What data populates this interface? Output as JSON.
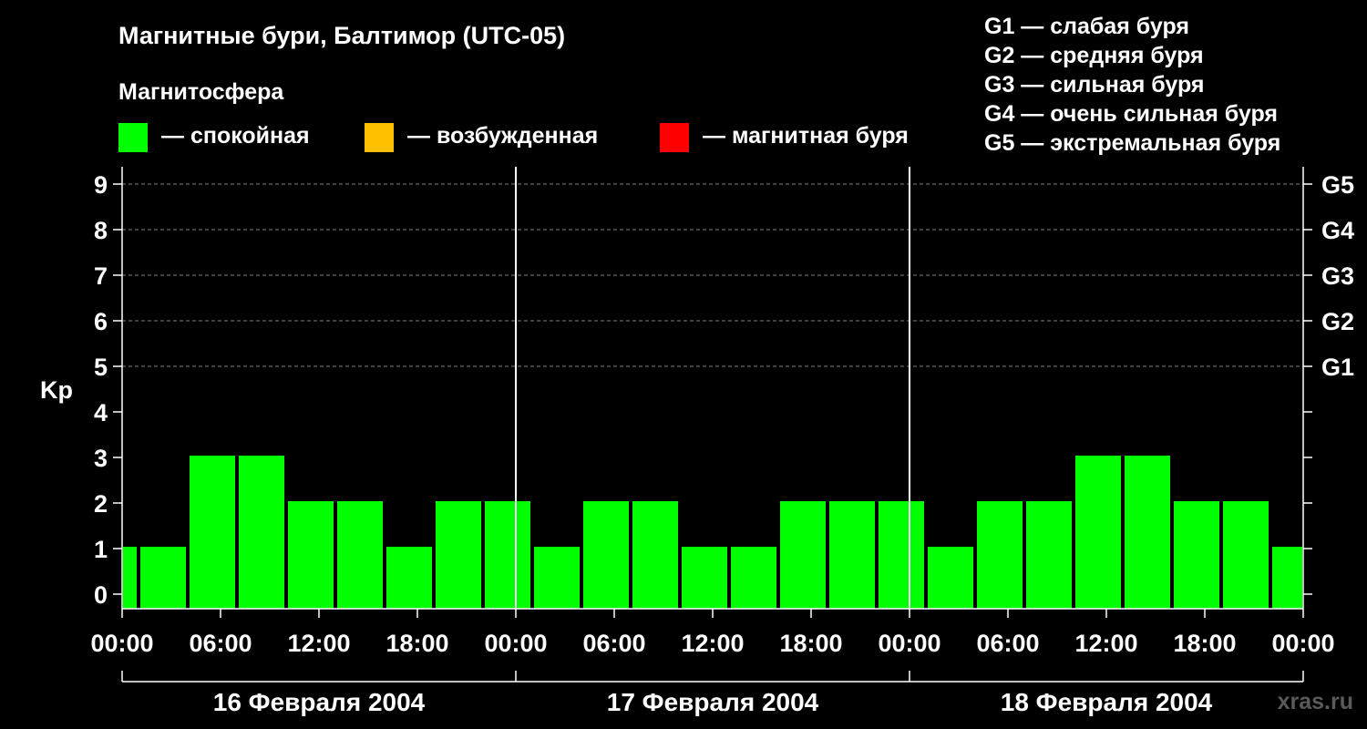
{
  "title": "Магнитные бури, Балтимор (UTC-05)",
  "subtitle": "Магнитосфера",
  "status_legend": [
    {
      "label": "— спокойная",
      "color": "#00ff00"
    },
    {
      "label": "— возбужденная",
      "color": "#ffc000"
    },
    {
      "label": "— магнитная буря",
      "color": "#ff0000"
    }
  ],
  "storm_legend": [
    "G1 — слабая буря",
    "G2 — средняя буря",
    "G3 — сильная буря",
    "G4 — очень сильная буря",
    "G5 — экстремальная буря"
  ],
  "watermark": "xras.ru",
  "colors": {
    "bar": "#00ff00",
    "background": "#000000",
    "axis": "#ffffff",
    "grid": "#808080"
  },
  "chart_data": {
    "type": "bar",
    "ylabel": "Kp",
    "ylim": [
      0,
      9
    ],
    "y_ticks": [
      "0",
      "1",
      "2",
      "3",
      "4",
      "5",
      "6",
      "7",
      "8",
      "9"
    ],
    "right_ticks": [
      {
        "value": 5,
        "label": "G1"
      },
      {
        "value": 6,
        "label": "G2"
      },
      {
        "value": 7,
        "label": "G3"
      },
      {
        "value": 8,
        "label": "G4"
      },
      {
        "value": 9,
        "label": "G5"
      }
    ],
    "grid_y": [
      5,
      6,
      7,
      8,
      9
    ],
    "x_hour_range": [
      0,
      72
    ],
    "x_tick_labels": [
      "00:00",
      "06:00",
      "12:00",
      "18:00",
      "00:00",
      "06:00",
      "12:00",
      "18:00",
      "00:00",
      "06:00",
      "12:00",
      "18:00",
      "00:00"
    ],
    "x_tick_hours": [
      0,
      6,
      12,
      18,
      24,
      30,
      36,
      42,
      48,
      54,
      60,
      66,
      72
    ],
    "days": [
      {
        "label": "16 Февраля 2004",
        "start_hour": 0,
        "end_hour": 24
      },
      {
        "label": "17 Февраля 2004",
        "start_hour": 24,
        "end_hour": 48
      },
      {
        "label": "18 Февраля 2004",
        "start_hour": 48,
        "end_hour": 72
      }
    ],
    "bars": [
      {
        "start": 0,
        "end": 1,
        "kp": 1
      },
      {
        "start": 1,
        "end": 4,
        "kp": 1
      },
      {
        "start": 4,
        "end": 7,
        "kp": 3
      },
      {
        "start": 7,
        "end": 10,
        "kp": 3
      },
      {
        "start": 10,
        "end": 13,
        "kp": 2
      },
      {
        "start": 13,
        "end": 16,
        "kp": 2
      },
      {
        "start": 16,
        "end": 19,
        "kp": 1
      },
      {
        "start": 19,
        "end": 22,
        "kp": 2
      },
      {
        "start": 22,
        "end": 25,
        "kp": 2
      },
      {
        "start": 25,
        "end": 28,
        "kp": 1
      },
      {
        "start": 28,
        "end": 31,
        "kp": 2
      },
      {
        "start": 31,
        "end": 34,
        "kp": 2
      },
      {
        "start": 34,
        "end": 37,
        "kp": 1
      },
      {
        "start": 37,
        "end": 40,
        "kp": 1
      },
      {
        "start": 40,
        "end": 43,
        "kp": 2
      },
      {
        "start": 43,
        "end": 46,
        "kp": 2
      },
      {
        "start": 46,
        "end": 49,
        "kp": 2
      },
      {
        "start": 49,
        "end": 52,
        "kp": 1
      },
      {
        "start": 52,
        "end": 55,
        "kp": 2
      },
      {
        "start": 55,
        "end": 58,
        "kp": 2
      },
      {
        "start": 58,
        "end": 61,
        "kp": 3
      },
      {
        "start": 61,
        "end": 64,
        "kp": 3
      },
      {
        "start": 64,
        "end": 67,
        "kp": 2
      },
      {
        "start": 67,
        "end": 70,
        "kp": 2
      },
      {
        "start": 70,
        "end": 72,
        "kp": 1
      }
    ]
  }
}
